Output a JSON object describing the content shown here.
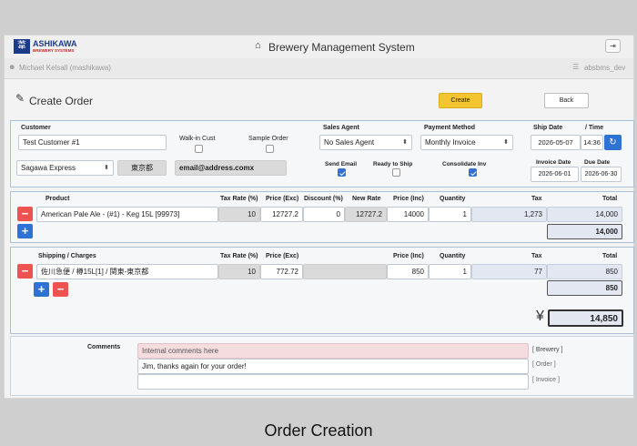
{
  "app": {
    "logo_line1": "ASHIKAWA",
    "logo_line2": "BREWERY SYSTEMS",
    "logo_mark": "葦",
    "title": "Brewery Management System",
    "user": "Michael Kelsall (mashikawa)",
    "db": "absbms_dev"
  },
  "page": {
    "title": "Create Order",
    "create_label": "Create",
    "back_label": "Back"
  },
  "form": {
    "customer_label": "Customer",
    "customer_value": "Test Customer #1",
    "walkin_label": "Walk-in Cust",
    "sample_label": "Sample Order",
    "sales_agent_label": "Sales Agent",
    "sales_agent_value": "No Sales Agent",
    "payment_label": "Payment Method",
    "payment_value": "Monthly Invoice",
    "ship_date_label": "Ship Date",
    "time_label": "/ Time",
    "ship_date_value": "2026-05-07",
    "time_value": "14:36",
    "carrier_value": "Sagawa Express",
    "region_value": "東京都",
    "email_value": "email@address.comx",
    "send_email_label": "Send Email",
    "ready_label": "Ready to Ship",
    "consolidate_label": "Consolidate Inv",
    "invoice_date_label": "Invoice Date",
    "due_date_label": "Due Date",
    "invoice_date_value": "2026-06-01",
    "due_date_value": "2026-06-30"
  },
  "products": {
    "headers": {
      "product": "Product",
      "tax_rate": "Tax Rate (%)",
      "price_exc": "Price (Exc)",
      "discount": "Discount (%)",
      "new_rate": "New Rate",
      "price_inc": "Price (Inc)",
      "quantity": "Quantity",
      "tax": "Tax",
      "total": "Total"
    },
    "row": {
      "product": "American Pale Ale - (#1) - Keg 15L [99973]",
      "tax_rate": "10",
      "price_exc": "12727.2",
      "discount": "0",
      "new_rate": "12727.2",
      "price_inc": "14000",
      "quantity": "1",
      "tax": "1,273",
      "total": "14,000"
    },
    "subtotal": "14,000"
  },
  "shipping": {
    "headers": {
      "label": "Shipping / Charges",
      "tax_rate": "Tax Rate (%)",
      "price_exc": "Price (Exc)",
      "price_inc": "Price (Inc)",
      "quantity": "Quantity",
      "tax": "Tax",
      "total": "Total"
    },
    "row": {
      "desc": "佐川急便 / 樽15L[1] / 関東-東京都",
      "tax_rate": "10",
      "price_exc": "772.72",
      "price_inc": "850",
      "quantity": "1",
      "tax": "77",
      "total": "850"
    },
    "subtotal": "850"
  },
  "grand": {
    "currency": "¥",
    "total": "14,850"
  },
  "comments": {
    "label": "Comments",
    "brewery_placeholder": "Internal comments here",
    "brewery_tag": "[ Brewery ]",
    "order_value": "Jim, thanks again for your order!",
    "order_tag": "[ Order ]",
    "invoice_value": "",
    "invoice_tag": "[ Invoice ]"
  },
  "caption": "Order Creation",
  "colors": {
    "create_button": "#f3c531",
    "minus_button": "#ef5350",
    "plus_button": "#2f72d6",
    "panel_border": "#aac0d6",
    "brewery_comment_bg": "#f4dcdf"
  }
}
